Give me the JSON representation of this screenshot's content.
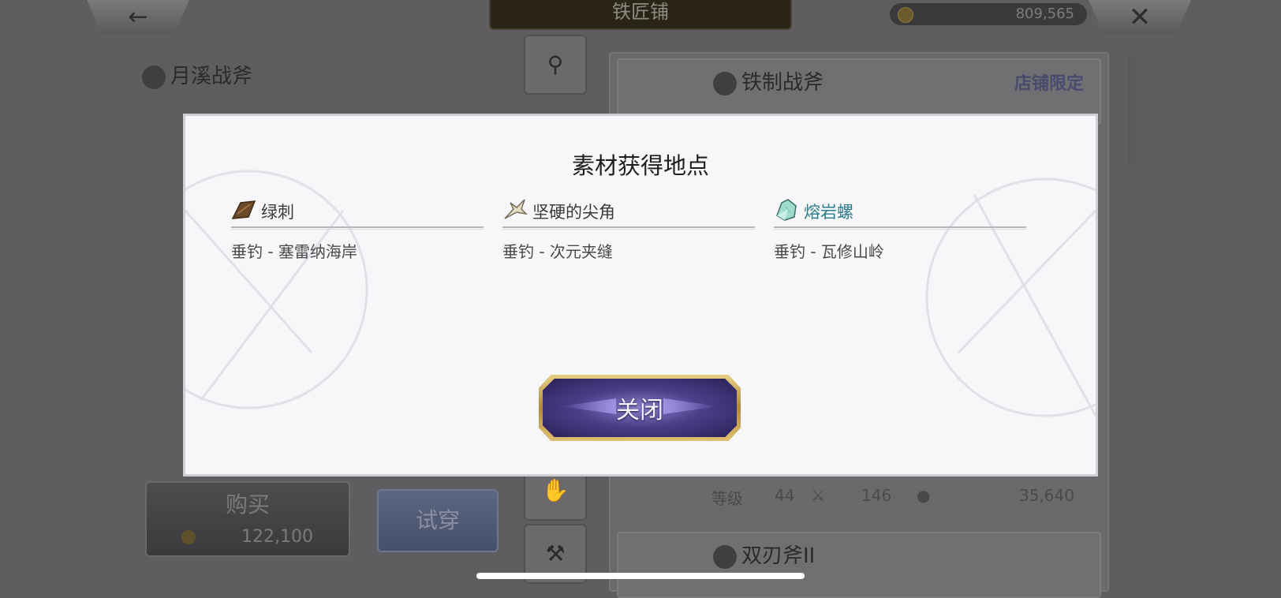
{
  "header": {
    "shop_title": "铁匠铺",
    "currency_amount": "809,565",
    "back_icon": "back-arrow-icon",
    "close_icon": "close-x-icon"
  },
  "left_panel": {
    "item_name": "月溪战斧",
    "buy_label": "购买",
    "buy_price": "122,100",
    "try_on_label": "试穿"
  },
  "shop_list": {
    "items": [
      {
        "name": "铁制战斧",
        "tag": "店铺限定"
      },
      {
        "level_label": "等级",
        "level": "44",
        "attack": "146",
        "price": "35,640"
      },
      {
        "name": "双刃斧II"
      }
    ]
  },
  "modal": {
    "title": "素材获得地点",
    "materials": [
      {
        "name": "绿刺",
        "source": "垂钓 - 塞雷纳海岸",
        "icon": "wood-material-icon",
        "color": "#3a3a3c"
      },
      {
        "name": "坚硬的尖角",
        "source": "垂钓 - 次元夹缝",
        "icon": "horn-material-icon",
        "color": "#3a3a3c"
      },
      {
        "name": "熔岩螺",
        "source": "垂钓 - 瓦修山岭",
        "icon": "crystal-material-icon",
        "color": "#2a7d8a"
      }
    ],
    "close_label": "关闭"
  }
}
